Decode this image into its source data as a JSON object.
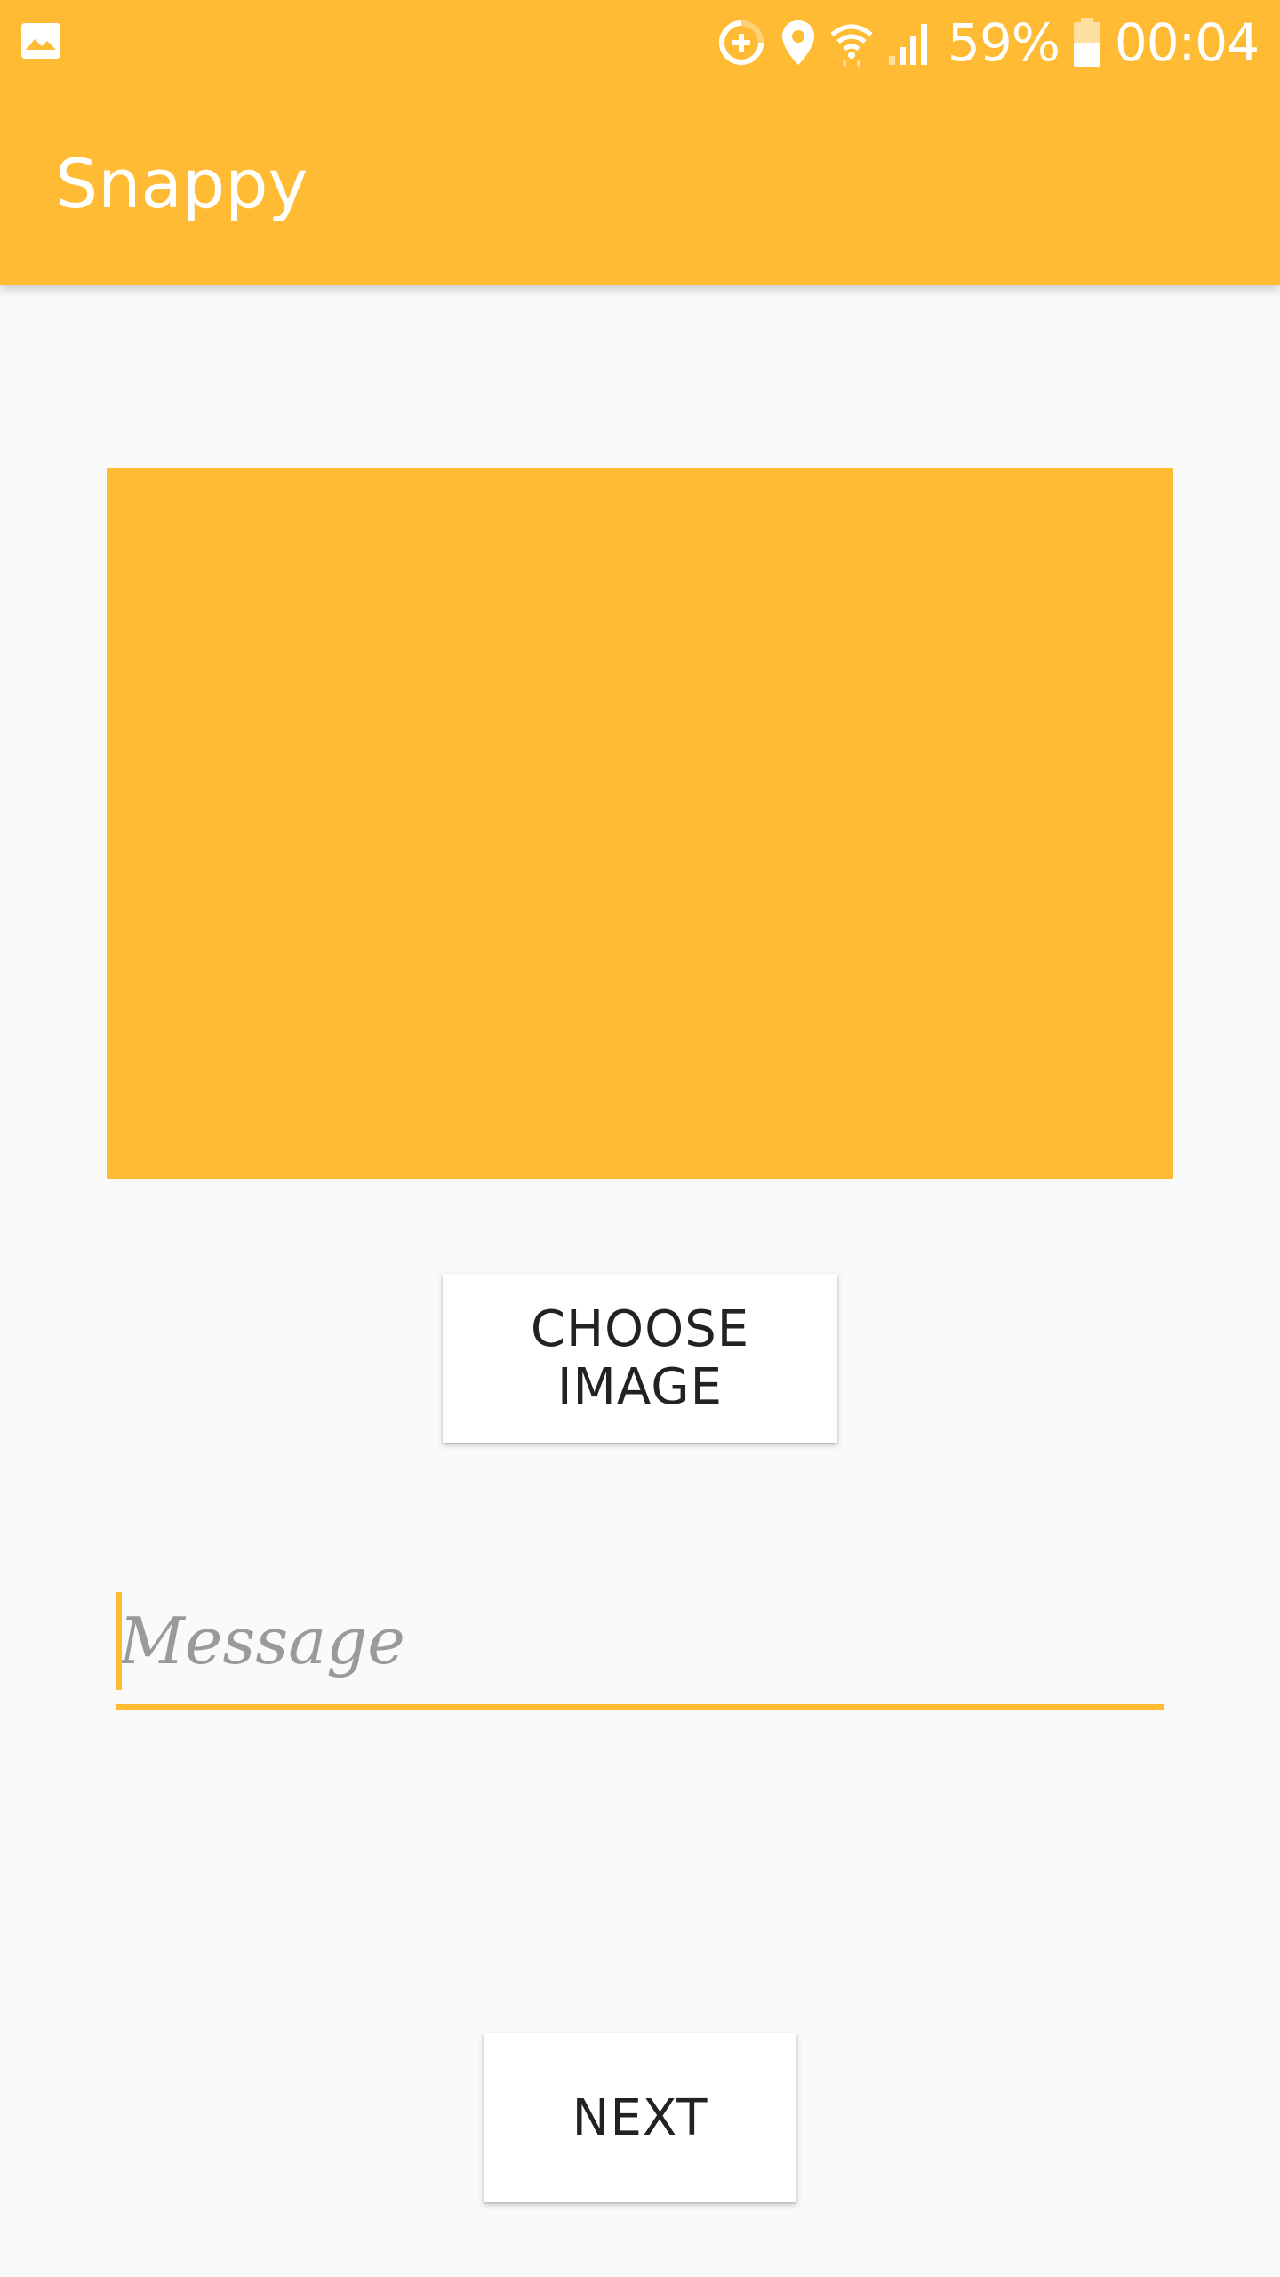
{
  "status_bar": {
    "battery_percent": "59%",
    "time": "00:04",
    "icons": [
      "gallery-icon",
      "data-saver-icon",
      "location-icon",
      "wifi-icon",
      "signal-icon",
      "battery-icon"
    ]
  },
  "app_bar": {
    "title": "Snappy"
  },
  "image_preview": {
    "color": "#ffbb33"
  },
  "choose_image_button": {
    "label": "CHOOSE IMAGE"
  },
  "message": {
    "placeholder": "Message",
    "value": ""
  },
  "next_button": {
    "label": "NEXT"
  },
  "colors": {
    "accent": "#ffbb33",
    "background": "#fafafa",
    "button": "#ffffff",
    "text": "#222222",
    "hint": "#9a9a9a"
  }
}
